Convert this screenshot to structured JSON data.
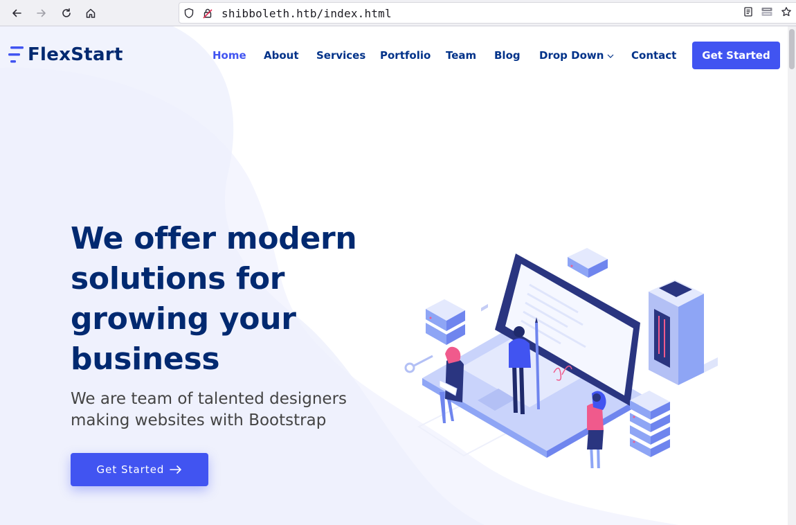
{
  "browser": {
    "url": "shibboleth.htb/index.html",
    "icons": [
      "back-icon",
      "forward-icon",
      "reload-icon",
      "home-icon",
      "shield-icon",
      "lock-icon",
      "reader-view-icon",
      "extension-icon",
      "bookmark-star-icon"
    ]
  },
  "header": {
    "logo_text": "FlexStart",
    "nav": [
      {
        "label": "Home",
        "active": true
      },
      {
        "label": "About"
      },
      {
        "label": "Services"
      },
      {
        "label": "Portfolio"
      },
      {
        "label": "Team"
      },
      {
        "label": "Blog"
      },
      {
        "label": "Drop Down",
        "has_dropdown": true
      },
      {
        "label": "Contact"
      }
    ],
    "cta_label": "Get Started"
  },
  "hero": {
    "title": "We offer modern solutions for growing your business",
    "subtitle": "We are team of talented designers making websites with Bootstrap",
    "cta_label": "Get Started"
  },
  "colors": {
    "primary": "#4154f1",
    "heading": "#012970",
    "nav_text": "#013289",
    "body_text": "#444444",
    "hero_bg": "#f4f5fe"
  }
}
